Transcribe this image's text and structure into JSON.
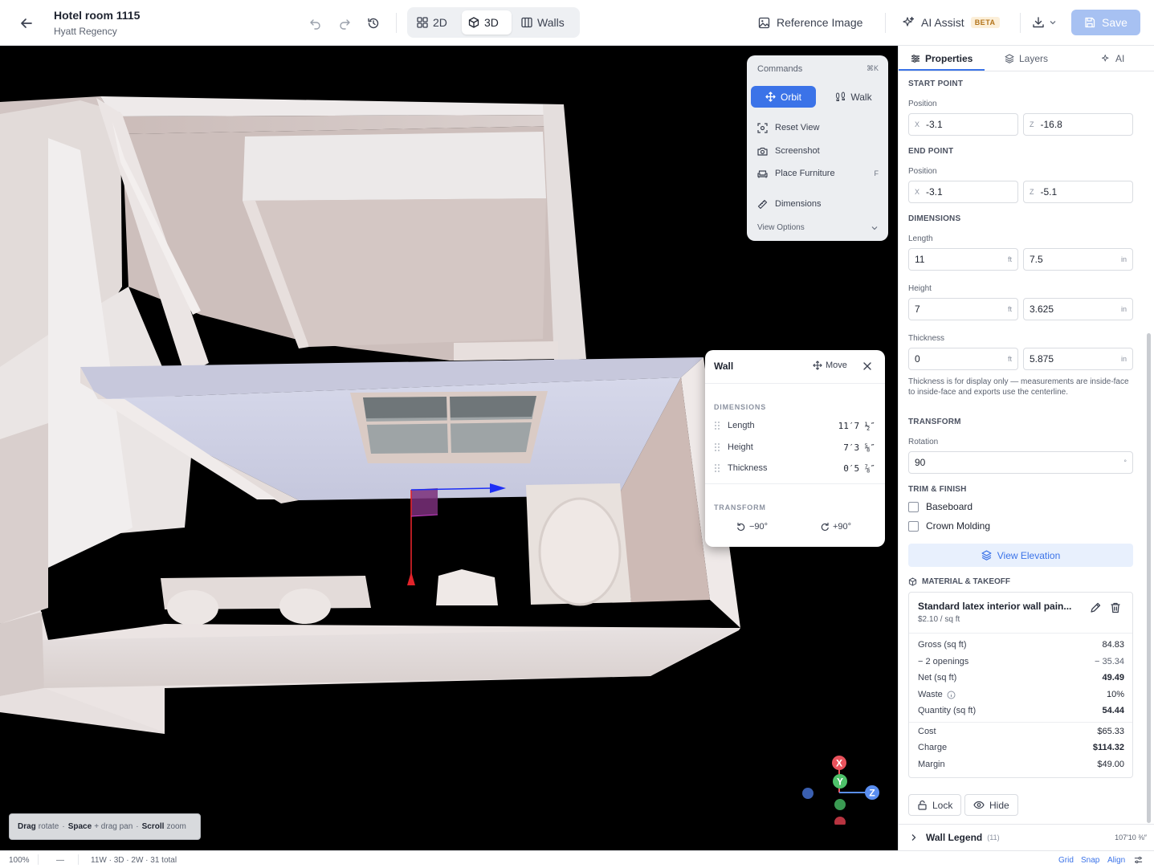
{
  "header": {
    "title": "Hotel room 1115",
    "subtitle": "Hyatt Regency",
    "view_modes": [
      {
        "label": "2D",
        "icon": "grid-icon"
      },
      {
        "label": "3D",
        "icon": "cube-icon",
        "active": true
      },
      {
        "label": "Walls",
        "icon": "walls-icon"
      }
    ],
    "reference_image_label": "Reference Image",
    "ai_assist_label": "AI Assist",
    "ai_badge": "BETA",
    "save_label": "Save"
  },
  "commands": {
    "title": "Commands",
    "shortcut": "⌘K",
    "orbit_label": "Orbit",
    "walk_label": "Walk",
    "items": [
      {
        "label": "Reset View",
        "icon": "reset-view-icon",
        "shortcut": ""
      },
      {
        "label": "Screenshot",
        "icon": "camera-icon",
        "shortcut": ""
      },
      {
        "label": "Place Furniture",
        "icon": "sofa-icon",
        "shortcut": "F"
      },
      {
        "label": "Dimensions",
        "icon": "ruler-icon",
        "shortcut": ""
      }
    ],
    "view_options_label": "View Options"
  },
  "wall_card": {
    "title": "Wall",
    "move_label": "Move",
    "dimensions_label": "DIMENSIONS",
    "rows": [
      {
        "label": "Length",
        "value": "11′7 ½″"
      },
      {
        "label": "Height",
        "value": "7′3 ⅝″"
      },
      {
        "label": "Thickness",
        "value": "0′5 ⅞″"
      }
    ],
    "transform_label": "TRANSFORM",
    "rotate_ccw_label": "−90°",
    "rotate_cw_label": "+90°"
  },
  "hint": {
    "drag": "Drag",
    "drag_action": "rotate",
    "space": "Space",
    "space_action": "+ drag pan",
    "scroll": "Scroll",
    "scroll_action": "zoom"
  },
  "gizmo": {
    "x": "X",
    "y": "Y",
    "z": "Z"
  },
  "panel": {
    "tabs": [
      {
        "label": "Properties",
        "icon": "sliders-icon",
        "active": true
      },
      {
        "label": "Layers",
        "icon": "layers-icon"
      },
      {
        "label": "AI",
        "icon": "sparkle-icon"
      }
    ],
    "start_point_label": "START POINT",
    "end_point_label": "END POINT",
    "position_label": "Position",
    "start": {
      "x": "-3.1",
      "z": "-16.8"
    },
    "end": {
      "x": "-3.1",
      "z": "-5.1"
    },
    "axis_x": "X",
    "axis_z": "Z",
    "dimensions_label": "DIMENSIONS",
    "length_label": "Length",
    "length_ft": "11",
    "length_in": "7.5",
    "height_label": "Height",
    "height_ft": "7",
    "height_in": "3.625",
    "thickness_label": "Thickness",
    "thickness_ft": "0",
    "thickness_in": "5.875",
    "unit_ft": "ft",
    "unit_in": "in",
    "thickness_note": "Thickness is for display only — measurements are inside-face to inside-face and exports use the centerline.",
    "transform_label": "TRANSFORM",
    "rotation_label": "Rotation",
    "rotation_value": "90",
    "rotation_unit": "°",
    "trim_label": "TRIM & FINISH",
    "baseboard_label": "Baseboard",
    "crown_label": "Crown Molding",
    "view_elevation_label": "View Elevation",
    "material_label": "MATERIAL & TAKEOFF",
    "material": {
      "name": "Standard latex interior wall pain...",
      "price": "$2.10 / sq ft",
      "rows": [
        {
          "label": "Gross (sq ft)",
          "value": "84.83"
        },
        {
          "label": "− 2 openings",
          "value": "− 35.34"
        },
        {
          "label": "Net (sq ft)",
          "value": "49.49"
        },
        {
          "label": "Waste",
          "value": "10%"
        },
        {
          "label": "Quantity (sq ft)",
          "value": "54.44"
        },
        {
          "label": "Cost",
          "value": "$65.33"
        },
        {
          "label": "Charge",
          "value": "$114.32"
        },
        {
          "label": "Margin",
          "value": "$49.00"
        }
      ]
    },
    "lock_label": "Lock",
    "hide_label": "Hide",
    "legend_label": "Wall Legend",
    "legend_count": "(11)",
    "legend_total": "107′10 ⅜″"
  },
  "status": {
    "zoom": "100%",
    "dash": "—",
    "info": "11W · 3D · 2W · 31 total",
    "grid": "Grid",
    "snap": "Snap",
    "align": "Align"
  },
  "colors": {
    "accent": "#3b73e8",
    "save_disabled": "#a7c1f2",
    "axis_x": "#e8525c",
    "axis_y": "#4ec26a",
    "axis_z": "#5a8ef0"
  }
}
